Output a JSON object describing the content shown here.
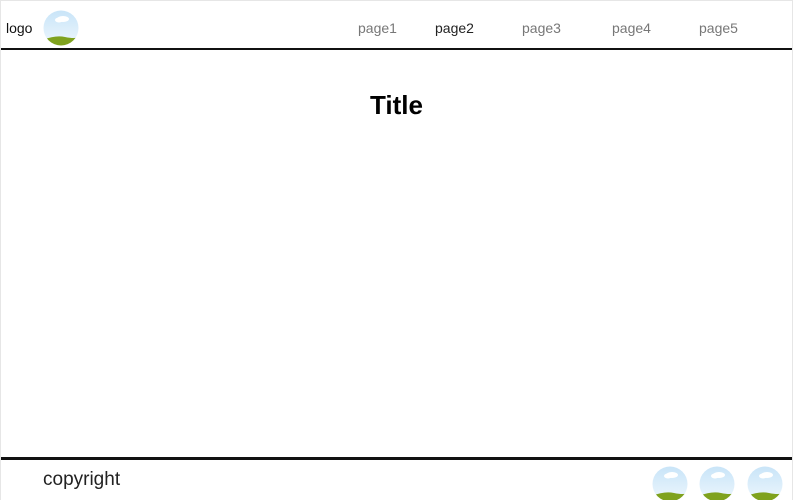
{
  "header": {
    "logo_text": "logo",
    "nav": [
      {
        "label": "page1",
        "active": false
      },
      {
        "label": "page2",
        "active": true
      },
      {
        "label": "page3",
        "active": false
      },
      {
        "label": "page4",
        "active": false
      },
      {
        "label": "page5",
        "active": false
      }
    ]
  },
  "main": {
    "title": "Title"
  },
  "footer": {
    "copyright": "copyright",
    "social_icons": [
      "landscape-image-icon",
      "landscape-image-icon",
      "landscape-image-icon"
    ]
  },
  "colors": {
    "sky": "#d7ecfa",
    "cloud": "#ffffff",
    "grass": "#7fa21e",
    "border": "#111111"
  }
}
